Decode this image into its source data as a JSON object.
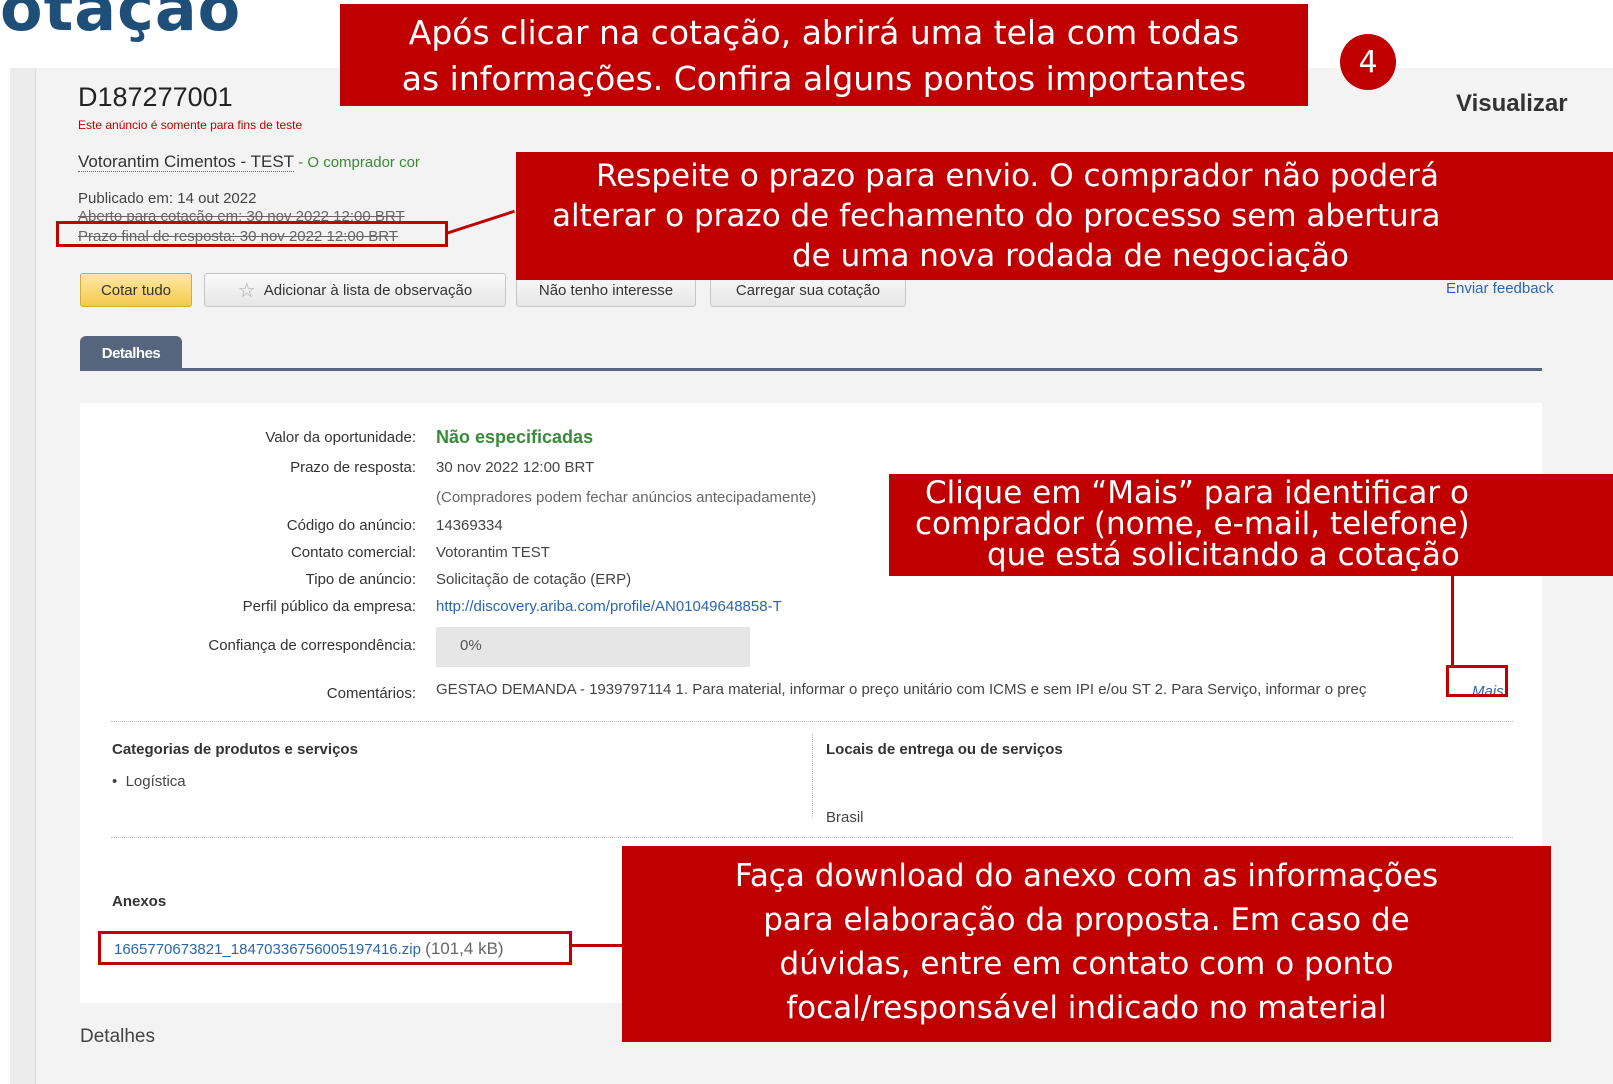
{
  "slide": {
    "title": "otação"
  },
  "header": {
    "doc_id": "D187277001",
    "test_note": "Este anúncio é somente para fins de teste",
    "visualizar": "Visualizar",
    "buyer_name": "Votorantim Cimentos - TEST",
    "buyer_note": " - O comprador cor",
    "published": "Publicado em: 14 out 2022",
    "open_for_quote": "Aberto para cotação em: 30 nov 2022 12:00 BRT",
    "deadline": "Prazo final de resposta: 30 nov 2022 12:00 BRT"
  },
  "toolbar": {
    "quote_all": "Cotar tudo",
    "add_watchlist": "Adicionar à lista de observação",
    "not_interested": "Não tenho interesse",
    "upload_quote": "Carregar sua cotação",
    "feedback": "Enviar feedback"
  },
  "tabs": {
    "details": "Detalhes"
  },
  "details": {
    "opportunity_value_label": "Valor da oportunidade:",
    "opportunity_value": "Não especificadas",
    "response_deadline_label": "Prazo de resposta:",
    "response_deadline": "30 nov 2022 12:00 BRT",
    "early_close_note": "(Compradores podem fechar anúncios antecipadamente)",
    "ad_code_label": "Código do anúncio:",
    "ad_code": "14369334",
    "commercial_contact_label": "Contato comercial:",
    "commercial_contact": "Votorantim TEST",
    "ad_type_label": "Tipo de anúncio:",
    "ad_type": "Solicitação de cotação  (ERP)",
    "company_profile_label": "Perfil público da empresa:",
    "company_profile": "http://discovery.ariba.com/profile/AN01049648858-T",
    "match_confidence_label": "Confiança de correspondência:",
    "match_confidence": "0%",
    "comments_label": "Comentários:",
    "comments": "GESTAO DEMANDA - 1939797114 1. Para material, informar o preço unitário com ICMS e sem IPI e/ou ST 2. Para Serviço, informar o preç",
    "more": "Mais"
  },
  "categories": {
    "heading": "Categorias de produtos e serviços",
    "items": [
      "Logística"
    ]
  },
  "delivery": {
    "heading": "Locais de entrega ou de serviços",
    "items": [
      "Brasil"
    ]
  },
  "attachments": {
    "heading": "Anexos",
    "file_name": "1665770673821_184703367560051974­16.zip",
    "file_size": "(101,4 kB)"
  },
  "footer": {
    "details": "Detalhes"
  },
  "callouts": {
    "intro": [
      "Após clicar na cotação, abrirá uma tela com todas",
      "as informações. Confira alguns pontos importantes"
    ],
    "step_number": "4",
    "deadline": [
      "Respeite o prazo para envio. O comprador não poderá",
      "alterar o prazo de fechamento do processo sem abertura",
      "de uma nova rodada de negociação"
    ],
    "more": [
      "Clique em “Mais” para identificar o",
      "comprador (nome, e-mail, telefone)",
      "que está solicitando a cotação"
    ],
    "download": [
      "Faça download do anexo com as informações",
      "para elaboração da proposta. Em caso de",
      "dúvidas, entre em contato com o ponto",
      "focal/responsável indicado no material"
    ]
  },
  "colors": {
    "callout": "#c00000",
    "tab": "#56657e",
    "link": "#2a66b0",
    "accent_green": "#3a8a3a",
    "title": "#1f4e79"
  }
}
